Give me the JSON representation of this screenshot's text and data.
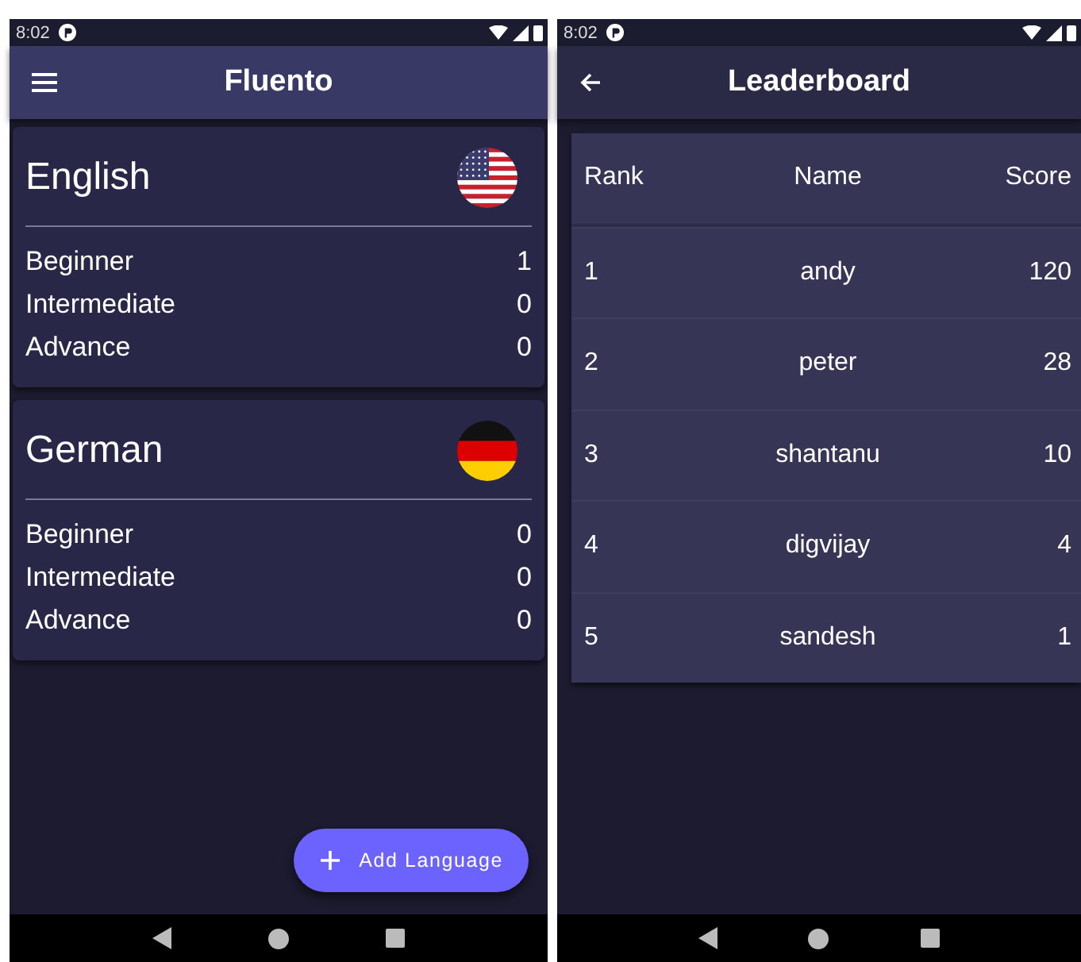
{
  "screens": [
    {
      "status_bar": {
        "time": "8:02"
      },
      "app_bar": {
        "nav_icon": {
          "kind": "menu"
        },
        "title": "Fluento"
      },
      "languages": [
        {
          "name": "English",
          "flag": {
            "kind": "us"
          },
          "levels": [
            {
              "label": "Beginner",
              "count": "1"
            },
            {
              "label": "Intermediate",
              "count": "0"
            },
            {
              "label": "Advance",
              "count": "0"
            }
          ]
        },
        {
          "name": "German",
          "flag": {
            "kind": "de"
          },
          "levels": [
            {
              "label": "Beginner",
              "count": "0"
            },
            {
              "label": "Intermediate",
              "count": "0"
            },
            {
              "label": "Advance",
              "count": "0"
            }
          ]
        }
      ],
      "fab": {
        "label": "Add Language"
      }
    },
    {
      "status_bar": {
        "time": "8:02"
      },
      "app_bar": {
        "nav_icon": {
          "kind": "back"
        },
        "title": "Leaderboard"
      },
      "table": {
        "columns": [
          "Rank",
          "Name",
          "Score"
        ],
        "rows": [
          [
            "1",
            "andy",
            "120"
          ],
          [
            "2",
            "peter",
            "28"
          ],
          [
            "3",
            "shantanu",
            "10"
          ],
          [
            "4",
            "digvijay",
            "4"
          ],
          [
            "5",
            "sandesh",
            "1"
          ]
        ]
      }
    }
  ]
}
